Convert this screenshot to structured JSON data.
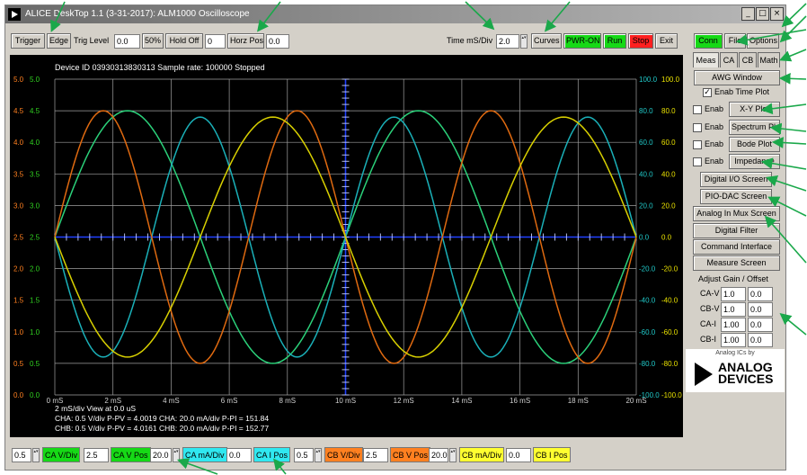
{
  "window": {
    "title": "ALICE DeskTop 1.1 (3-31-2017): ALM1000 Oscilloscope"
  },
  "window_buttons": [
    "_",
    "□",
    "×"
  ],
  "toolbar": {
    "trigger": "Trigger",
    "edge": "Edge",
    "trig_level_label": "Trig Level",
    "trig_level_value": "0.0",
    "fifty_pct": "50%",
    "hold_off": "Hold Off",
    "hold_off_value": "0",
    "horz_pos": "Horz Pos",
    "horz_pos_value": "0.0",
    "time_label": "Time mS/Div",
    "time_value": "2.0",
    "curves": "Curves",
    "pwr_on": "PWR-ON",
    "run": "Run",
    "stop": "Stop",
    "exit": "Exit"
  },
  "right_panel": {
    "conn": "Conn",
    "file": "File",
    "options": "Options",
    "tabs": [
      "Meas",
      "CA",
      "CB",
      "Math"
    ],
    "awg": "AWG Window",
    "check_mark": "✓",
    "enab_time_plot": "Enab Time Plot",
    "enab": "Enab",
    "xy_plot": "X-Y Plot",
    "spectrum_plot": "Spectrum Plot",
    "bode_plot": "Bode Plot",
    "impedance": "Impedance",
    "digital_io": "Digital I/O Screen",
    "pio_dac": "PIO-DAC Screen",
    "analog_mux": "Analog In Mux Screen",
    "digital_filter": "Digital Filter",
    "command_interface": "Command Interface",
    "measure_screen": "Measure Screen",
    "adjust_title": "Adjust Gain / Offset",
    "adjust_rows": [
      {
        "label": "CA-V",
        "gain": "1.0",
        "offset": "0.0"
      },
      {
        "label": "CB-V",
        "gain": "1.0",
        "offset": "0.0"
      },
      {
        "label": "CA-I",
        "gain": "1.00",
        "offset": "0.0"
      },
      {
        "label": "CB-I",
        "gain": "1.00",
        "offset": "0.0"
      }
    ],
    "logo_caption": "Analog ICs by",
    "logo_line1": "ANALOG",
    "logo_line2": "DEVICES"
  },
  "scope": {
    "header": "Device ID 03930313830313 Sample rate: 100000 Stopped",
    "footer1": "2 mS/div   View at 0.0 uS",
    "footer2": "CHA: 0.5 V/div P-PV =  4.0019 CHA: 20.0 mA/div P-PI =  151.84",
    "footer3": "CHB: 0.5 V/div P-PV =  4.0161 CHB: 20.0 mA/div P-PI =  152.77",
    "x_ticks": [
      "0 mS",
      "2 mS",
      "4 mS",
      "6 mS",
      "8 mS",
      "10 mS",
      "12 mS",
      "14 mS",
      "16 mS",
      "18 mS",
      "20 mS"
    ],
    "y_left_ticks": [
      "0.0",
      "0.5",
      "1.0",
      "1.5",
      "2.0",
      "2.5",
      "3.0",
      "3.5",
      "4.0",
      "4.5",
      "5.0"
    ],
    "y_right_ticks": [
      "-100.0",
      "-80.0",
      "-60.0",
      "-40.0",
      "-20.0",
      "0.0",
      "20.0",
      "40.0",
      "60.0",
      "80.0",
      "100.0"
    ],
    "trace_colors": {
      "ca_v": "#2bd17a",
      "cb_v": "#e06a10",
      "ca_i": "#1ab0b8",
      "cb_i": "#d8d000"
    },
    "colors": {
      "ca_v": "#30d020",
      "cb_v": "#ff8020",
      "ca_i": "#20c8c8",
      "cb_i": "#e8e000",
      "grid": "#a0a0a0",
      "center": "#2040ff"
    },
    "traces": {
      "ca_v": {
        "label": "CA V/Div",
        "frequency_cycles_per_20ms": 2,
        "phase_cycles": 0,
        "amplitude_v": 2.0,
        "offset_v": 2.5
      },
      "cb_v": {
        "label": "CB V/Div",
        "frequency_cycles_per_20ms": 3,
        "phase_cycles": 0,
        "amplitude_v": 2.0,
        "offset_v": 2.5
      },
      "ca_i": {
        "label": "CA mA/Div",
        "frequency_cycles_per_20ms": 3,
        "phase_cycles": 0.5,
        "amplitude_ma": 76,
        "offset_ma": 0
      },
      "cb_i": {
        "label": "CB mA/Div",
        "frequency_cycles_per_20ms": 2,
        "phase_cycles": 0.5,
        "amplitude_ma": 76,
        "offset_ma": 0
      }
    }
  },
  "bottom": {
    "ca_vdiv_value": "0.5",
    "ca_vdiv": "CA V/Div",
    "ca_vpos_value": "2.5",
    "ca_vpos": "CA V Pos",
    "ca_madiv_value": "20.0",
    "ca_madiv": "CA mA/Div",
    "ca_ipos_value": "0.0",
    "ca_ipos": "CA I Pos",
    "cb_vdiv_value": "0.5",
    "cb_vdiv": "CB V/Div",
    "cb_vpos_value": "2.5",
    "cb_vpos": "CB V Pos",
    "cb_madiv_value": "20.0",
    "cb_madiv": "CB mA/Div",
    "cb_ipos_value": "0.0",
    "cb_ipos": "CB I Pos",
    "spin_glyph": "▴▾"
  }
}
